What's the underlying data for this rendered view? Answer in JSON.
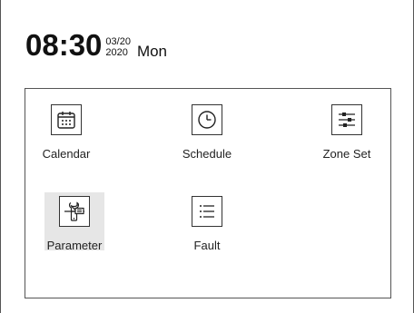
{
  "status": {
    "time": "08:30",
    "date_top": "03/20",
    "date_bottom": "2020",
    "weekday": "Mon"
  },
  "menu": {
    "items": [
      {
        "label": "Calendar",
        "icon": "calendar-icon"
      },
      {
        "label": "Schedule",
        "icon": "clock-icon"
      },
      {
        "label": "Zone Set",
        "icon": "sliders-icon"
      },
      {
        "label": "Parameter",
        "icon": "wrench-settings-icon",
        "selected": true
      },
      {
        "label": "Fault",
        "icon": "list-icon"
      }
    ]
  },
  "colors": {
    "selected_bg": "#e6e6e6",
    "border": "#555555",
    "text": "#1a1a1a"
  }
}
